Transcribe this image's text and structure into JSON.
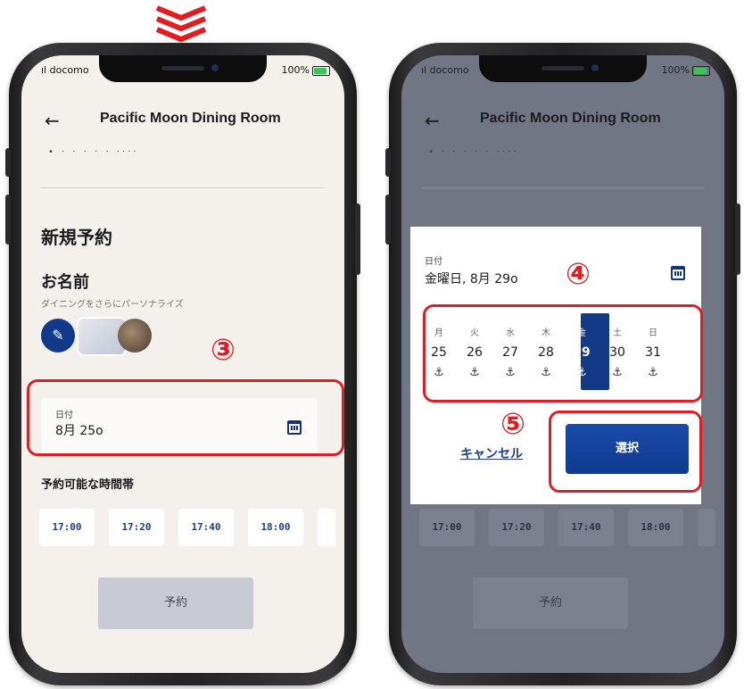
{
  "status": {
    "carrier": "docomo",
    "battery": "100%"
  },
  "header": {
    "back_icon": "←",
    "title": "Pacific Moon Dining Room",
    "subtitle_dots": "•  ·  ·  ·  ·  ·  ····"
  },
  "form": {
    "section_title": "新規予約",
    "name_label": "お名前",
    "name_hint": "ダイニングをさらにパーソナライズ",
    "edit_icon": "✎"
  },
  "date_field": {
    "label": "日付",
    "value": "8月 25o"
  },
  "timeslots_title": "予約可能な時間帯",
  "timeslots": [
    "17:00",
    "17:20",
    "17:40",
    "18:00"
  ],
  "reserve_button": "予約",
  "annotations": {
    "step3": "③",
    "step4": "④",
    "step5": "⑤"
  },
  "modal": {
    "label": "日付",
    "value": "金曜日, 8月 29o",
    "weekdays": [
      "月",
      "火",
      "水",
      "木",
      "金",
      "土",
      "日"
    ],
    "days": [
      "25",
      "26",
      "27",
      "28",
      "29",
      "30",
      "31"
    ],
    "anchor_icon": "⚓",
    "selected_index": 4,
    "cancel": "キャンセル",
    "select": "選択"
  },
  "colors": {
    "accent": "#123a86",
    "annotation": "#e11d22",
    "light_bg": "#f4f1ec",
    "dim_bg": "#707684"
  }
}
